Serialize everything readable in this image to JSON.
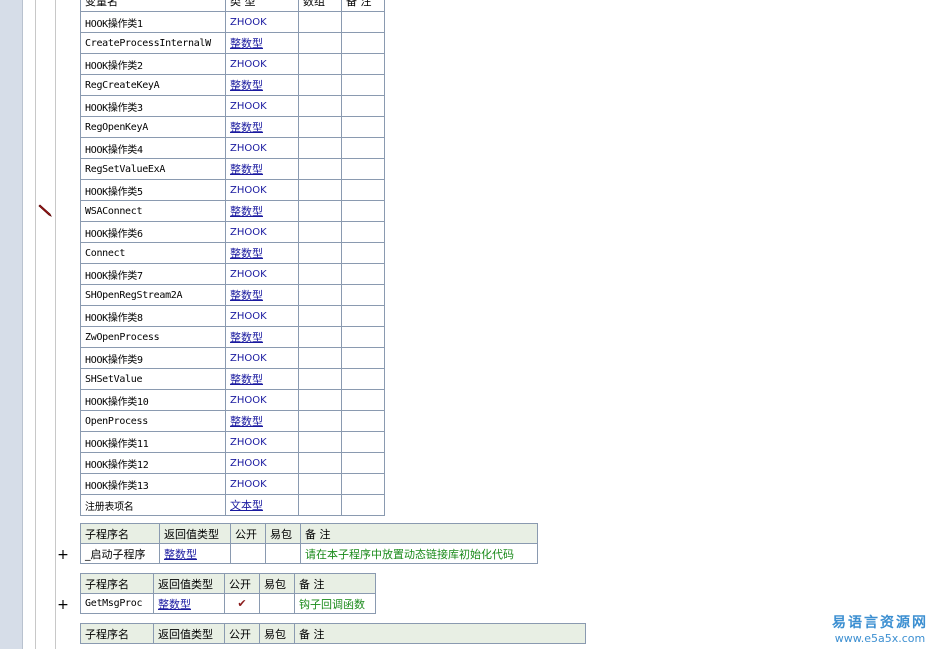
{
  "variables": {
    "headers": {
      "name": "变量名",
      "type": "类 型",
      "array": "数组",
      "note": "备 注"
    },
    "rows": [
      {
        "name": "HOOK操作类1",
        "type": "ZHOOK"
      },
      {
        "name": "CreateProcessInternalW",
        "type": "整数型"
      },
      {
        "name": "HOOK操作类2",
        "type": "ZHOOK"
      },
      {
        "name": "RegCreateKeyA",
        "type": "整数型"
      },
      {
        "name": "HOOK操作类3",
        "type": "ZHOOK"
      },
      {
        "name": "RegOpenKeyA",
        "type": "整数型"
      },
      {
        "name": "HOOK操作类4",
        "type": "ZHOOK"
      },
      {
        "name": "RegSetValueExA",
        "type": "整数型"
      },
      {
        "name": "HOOK操作类5",
        "type": "ZHOOK"
      },
      {
        "name": "WSAConnect",
        "type": "整数型"
      },
      {
        "name": "HOOK操作类6",
        "type": "ZHOOK"
      },
      {
        "name": "Connect",
        "type": "整数型"
      },
      {
        "name": "HOOK操作类7",
        "type": "ZHOOK"
      },
      {
        "name": "SHOpenRegStream2A",
        "type": "整数型"
      },
      {
        "name": "HOOK操作类8",
        "type": "ZHOOK"
      },
      {
        "name": "ZwOpenProcess",
        "type": "整数型"
      },
      {
        "name": "HOOK操作类9",
        "type": "ZHOOK"
      },
      {
        "name": "SHSetValue",
        "type": "整数型"
      },
      {
        "name": "HOOK操作类10",
        "type": "ZHOOK"
      },
      {
        "name": "OpenProcess",
        "type": "整数型"
      },
      {
        "name": "HOOK操作类11",
        "type": "ZHOOK"
      },
      {
        "name": "HOOK操作类12",
        "type": "ZHOOK"
      },
      {
        "name": "HOOK操作类13",
        "type": "ZHOOK"
      },
      {
        "name": "注册表项名",
        "type": "文本型"
      }
    ]
  },
  "sub_headers": {
    "name": "子程序名",
    "ret": "返回值类型",
    "public": "公开",
    "pkg": "易包",
    "note": "备 注"
  },
  "subs": [
    {
      "name": "_启动子程序",
      "ret": "整数型",
      "public": "",
      "note": "请在本子程序中放置动态链接库初始化代码"
    },
    {
      "name": "GetMsgProc",
      "ret": "整数型",
      "public": "✔",
      "note": "钩子回调函数"
    }
  ],
  "gutter": {
    "plus": "+"
  },
  "watermark": {
    "title": "易语言资源网",
    "url": "www.e5a5x.com"
  }
}
